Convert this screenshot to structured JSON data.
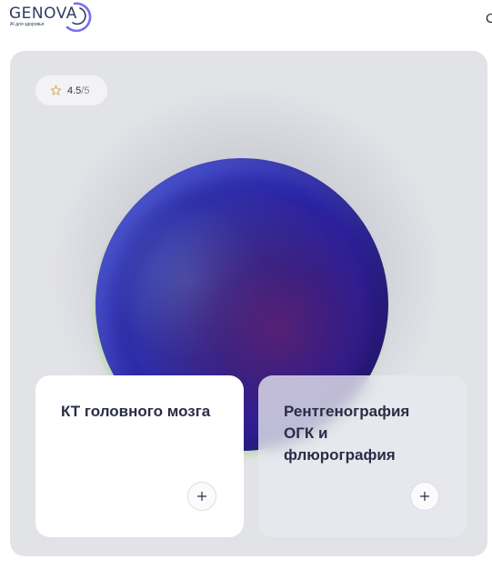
{
  "header": {
    "logo": {
      "word": "GENOVA",
      "tagline": "AI для здоровья"
    },
    "clipped_text": "С"
  },
  "hero": {
    "rating": {
      "value": "4.5",
      "max": "/5",
      "icon": "star-outline-icon"
    },
    "services": [
      {
        "title": "КТ головного мозга",
        "button_icon": "plus-icon"
      },
      {
        "title": "Рентгенография ОГК и флюрография",
        "button_icon": "plus-icon"
      }
    ]
  },
  "colors": {
    "brand": "#2f3a63",
    "accent_purple": "#6c5ce7",
    "card_bg": "#e2e3e7",
    "text_dark": "#2a2d45"
  }
}
